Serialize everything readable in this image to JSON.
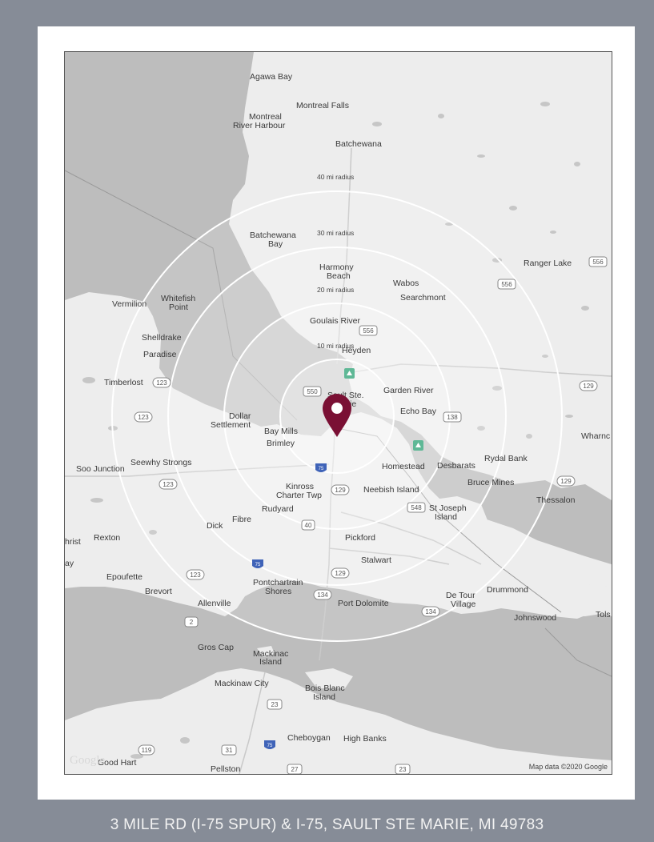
{
  "map": {
    "labels": {
      "agawa_bay": "Agawa Bay",
      "montreal_falls": "Montreal Falls",
      "montreal_river_1": "Montreal",
      "montreal_river_2": "River Harbour",
      "batchewana": "Batchewana",
      "batchewana_bay_1": "Batchewana",
      "batchewana_bay_2": "Bay",
      "harmony_beach_1": "Harmony",
      "harmony_beach_2": "Beach",
      "wabos": "Wabos",
      "searchmont": "Searchmont",
      "ranger_lake": "Ranger Lake",
      "vermilion": "Vermilion",
      "whitefish_point_1": "Whitefish",
      "whitefish_point_2": "Point",
      "shelldrake": "Shelldrake",
      "paradise": "Paradise",
      "goulais_river": "Goulais River",
      "heyden": "Heyden",
      "timberlost": "Timberlost",
      "sault_ste_marie_1": "Sault Ste.",
      "sault_ste_marie_2": "Marie",
      "garden_river": "Garden River",
      "echo_bay": "Echo Bay",
      "dollar_settlement_1": "Dollar",
      "dollar_settlement_2": "Settlement",
      "bay_mills": "Bay Mills",
      "brimley": "Brimley",
      "wharncliffe": "Wharnc",
      "soo_junction": "Soo Junction",
      "seewhy_strongs": "Seewhy Strongs",
      "homestead": "Homestead",
      "desbarats": "Desbarats",
      "rydal_bank": "Rydal Bank",
      "bruce_mines": "Bruce Mines",
      "thessalon": "Thessalon",
      "kinross_1": "Kinross",
      "kinross_2": "Charter Twp",
      "neebish_island": "Neebish Island",
      "st_joseph_island_1": "St Joseph",
      "st_joseph_island_2": "Island",
      "rudyard": "Rudyard",
      "fibre": "Fibre",
      "dick": "Dick",
      "rexton": "Rexton",
      "hrist": "hrist",
      "pickford": "Pickford",
      "stalwart": "Stalwart",
      "epoufette": "Epoufette",
      "brevort": "Brevort",
      "pontchartrain_1": "Pontchartrain",
      "pontchartrain_2": "Shores",
      "port_dolomite": "Port Dolomite",
      "de_tour_1": "De Tour",
      "de_tour_2": "Village",
      "drummond": "Drummond",
      "johnswood": "Johnswood",
      "tols": "Tols",
      "allenville": "Allenville",
      "gros_cap": "Gros Cap",
      "mackinac_1": "Mackinac",
      "mackinac_2": "Island",
      "mackinaw_city": "Mackinaw City",
      "bois_blanc_1": "Bois Blanc",
      "bois_blanc_2": "Island",
      "cheboygan": "Cheboygan",
      "high_banks": "High Banks",
      "good_hart": "Good Hart",
      "pellston": "Pellston",
      "ay": "ay"
    },
    "shields": {
      "s556a": "556",
      "s556b": "556",
      "s556c": "556",
      "s550": "550",
      "s123a": "123",
      "s123b": "123",
      "s123c": "123",
      "s123d": "123",
      "s129a": "129",
      "s129b": "129",
      "s129c": "129",
      "s129d": "129",
      "s138": "138",
      "s548": "548",
      "s134a": "134",
      "s134b": "134",
      "s2": "2",
      "s23a": "23",
      "s23b": "23",
      "s119": "119",
      "s31": "31",
      "s27": "27",
      "s75a": "75",
      "s75b": "75",
      "s75c": "75",
      "s40": "40"
    },
    "radius_labels": [
      "10 mi radius",
      "20 mi radius",
      "30 mi radius",
      "40 mi radius"
    ],
    "radii_miles": [
      10,
      20,
      30,
      40
    ],
    "attribution": "Map data ©2020 Google",
    "google_logo": "Google",
    "pin_color": "#7a1034",
    "pin_icon": "map-pin-icon",
    "park_icon": "park-icon"
  },
  "address": "3 MILE RD (I-75 SPUR) & I-75, SAULT STE MARIE, MI 49783"
}
